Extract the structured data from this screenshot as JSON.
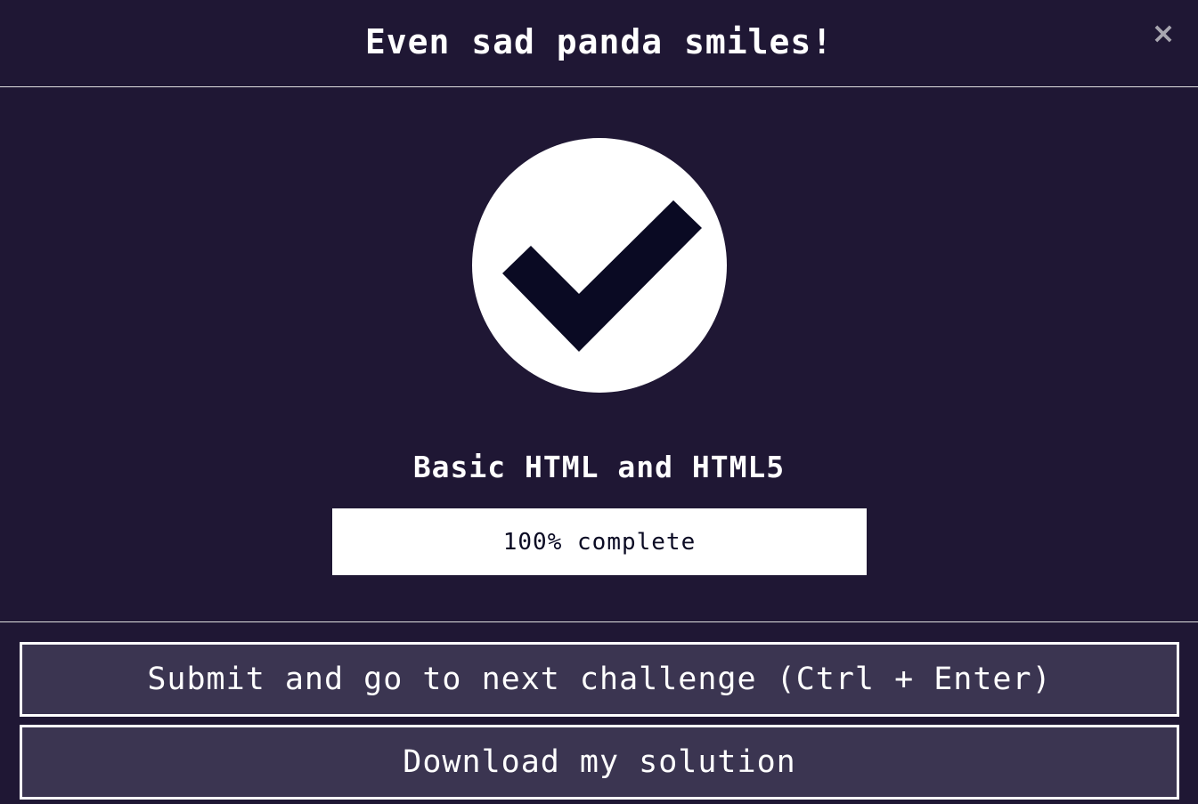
{
  "modal": {
    "title": "Even sad panda smiles!",
    "close_label": "×",
    "completion_icon": "checkmark-circle-icon",
    "block_title": "Basic HTML and HTML5",
    "progress": {
      "percent": 100,
      "text": "100% complete"
    },
    "buttons": {
      "submit_label": "Submit and go to next challenge (Ctrl + Enter)",
      "download_label": "Download my solution"
    }
  },
  "colors": {
    "background": "#1f1734",
    "button_background": "#3b3551",
    "check_mark": "#0a0a23",
    "text": "#ffffff",
    "close_icon": "#a8a6b0"
  }
}
